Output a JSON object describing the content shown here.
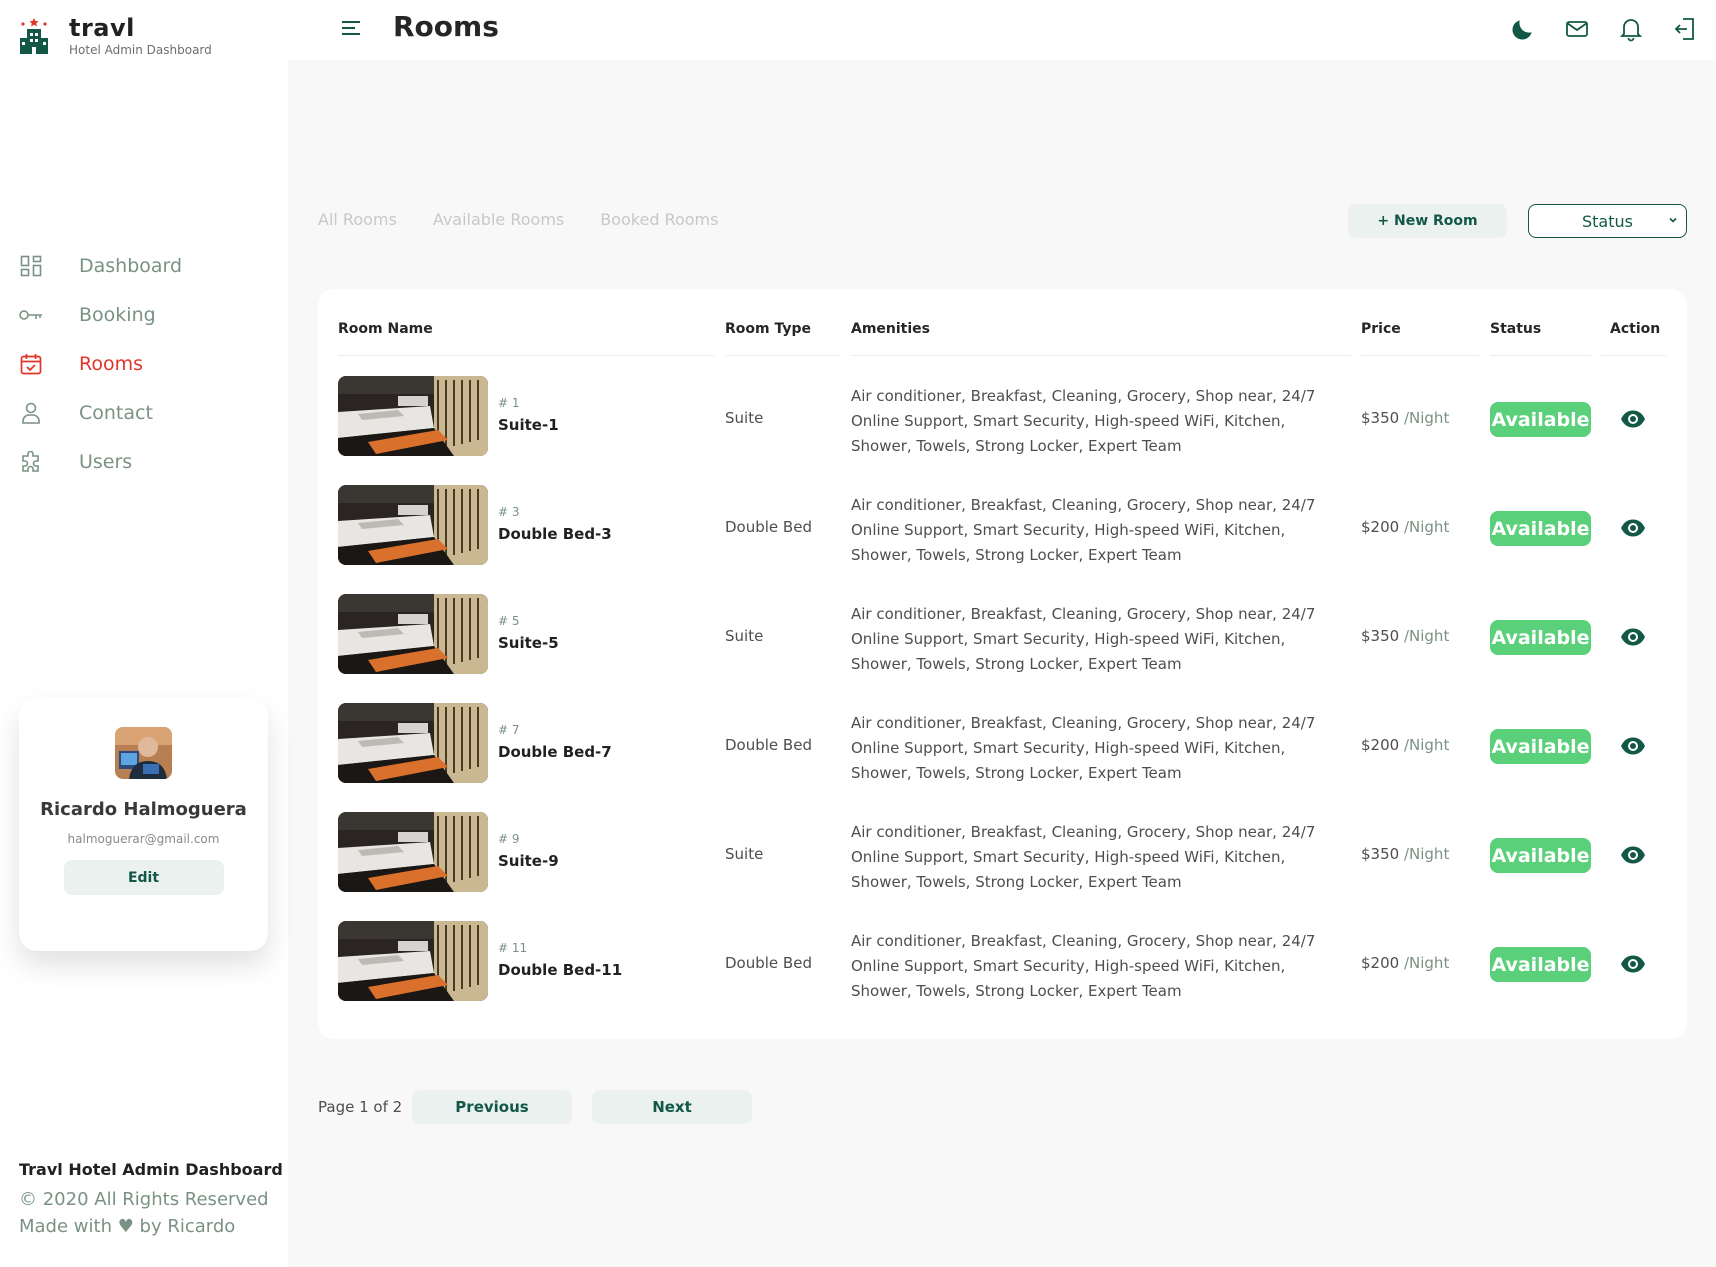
{
  "brand": {
    "title": "travl",
    "subtitle": "Hotel Admin Dashboard"
  },
  "header": {
    "title": "Rooms",
    "icons": [
      "moon-icon",
      "mail-icon",
      "bell-icon",
      "logout-icon"
    ]
  },
  "sidebar": {
    "items": [
      {
        "label": "Dashboard",
        "icon": "dashboard-icon",
        "active": false
      },
      {
        "label": "Booking",
        "icon": "key-icon",
        "active": false
      },
      {
        "label": "Rooms",
        "icon": "calendar-icon",
        "active": true
      },
      {
        "label": "Contact",
        "icon": "user-icon",
        "active": false
      },
      {
        "label": "Users",
        "icon": "puzzle-icon",
        "active": false
      }
    ],
    "active_color": "#e23428",
    "inactive_color": "#799283"
  },
  "profile": {
    "name": "Ricardo Halmoguera",
    "email": "halmoguerar@gmail.com",
    "edit_label": "Edit"
  },
  "footer": {
    "title": "Travl Hotel Admin Dashboard",
    "copyright": "© 2020 All Rights Reserved",
    "made_with": "Made with ♥ by Ricardo"
  },
  "tabs": [
    "All Rooms",
    "Available Rooms",
    "Booked Rooms"
  ],
  "actions": {
    "new_room": "+ New Room",
    "status_select": "Status"
  },
  "table": {
    "headers": {
      "name": "Room Name",
      "type": "Room Type",
      "amenities": "Amenities",
      "price": "Price",
      "status": "Status",
      "action": "Action"
    },
    "rows": [
      {
        "number": "# 1",
        "name": "Suite-1",
        "type": "Suite",
        "amenities": "Air conditioner, Breakfast, Cleaning, Grocery, Shop near, 24/7 Online Support, Smart Security, High-speed WiFi, Kitchen, Shower, Towels, Strong Locker, Expert Team",
        "price": "$350",
        "per": "/Night",
        "status": "Available"
      },
      {
        "number": "# 3",
        "name": "Double Bed-3",
        "type": "Double Bed",
        "amenities": "Air conditioner, Breakfast, Cleaning, Grocery, Shop near, 24/7 Online Support, Smart Security, High-speed WiFi, Kitchen, Shower, Towels, Strong Locker, Expert Team",
        "price": "$200",
        "per": "/Night",
        "status": "Available"
      },
      {
        "number": "# 5",
        "name": "Suite-5",
        "type": "Suite",
        "amenities": "Air conditioner, Breakfast, Cleaning, Grocery, Shop near, 24/7 Online Support, Smart Security, High-speed WiFi, Kitchen, Shower, Towels, Strong Locker, Expert Team",
        "price": "$350",
        "per": "/Night",
        "status": "Available"
      },
      {
        "number": "# 7",
        "name": "Double Bed-7",
        "type": "Double Bed",
        "amenities": "Air conditioner, Breakfast, Cleaning, Grocery, Shop near, 24/7 Online Support, Smart Security, High-speed WiFi, Kitchen, Shower, Towels, Strong Locker, Expert Team",
        "price": "$200",
        "per": "/Night",
        "status": "Available"
      },
      {
        "number": "# 9",
        "name": "Suite-9",
        "type": "Suite",
        "amenities": "Air conditioner, Breakfast, Cleaning, Grocery, Shop near, 24/7 Online Support, Smart Security, High-speed WiFi, Kitchen, Shower, Towels, Strong Locker, Expert Team",
        "price": "$350",
        "per": "/Night",
        "status": "Available"
      },
      {
        "number": "# 11",
        "name": "Double Bed-11",
        "type": "Double Bed",
        "amenities": "Air conditioner, Breakfast, Cleaning, Grocery, Shop near, 24/7 Online Support, Smart Security, High-speed WiFi, Kitchen, Shower, Towels, Strong Locker, Expert Team",
        "price": "$200",
        "per": "/Night",
        "status": "Available"
      }
    ]
  },
  "pagination": {
    "info": "Page 1 of 2",
    "previous": "Previous",
    "next": "Next"
  },
  "colors": {
    "brand_green": "#135846",
    "available_green": "#5ad07a",
    "muted_green": "#799283"
  }
}
